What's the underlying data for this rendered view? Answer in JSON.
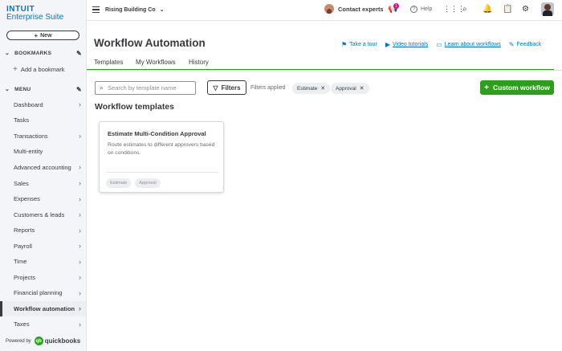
{
  "brand": {
    "logo": "INTUIT",
    "product": "Enterprise Suite",
    "powered_by": "Powered by",
    "qb": "quickbooks",
    "qb_mark": "qb"
  },
  "sidebar": {
    "new_label": "New",
    "bookmarks_header": "BOOKMARKS",
    "add_bookmark": "Add a bookmark",
    "menu_header": "MENU",
    "items": [
      {
        "label": "Dashboard",
        "arrow": true
      },
      {
        "label": "Tasks",
        "arrow": false
      },
      {
        "label": "Transactions",
        "arrow": true
      },
      {
        "label": "Multi-entity",
        "arrow": false
      },
      {
        "label": "Advanced accounting",
        "arrow": true
      },
      {
        "label": "Sales",
        "arrow": true
      },
      {
        "label": "Expenses",
        "arrow": true
      },
      {
        "label": "Customers & leads",
        "arrow": true
      },
      {
        "label": "Reports",
        "arrow": true
      },
      {
        "label": "Payroll",
        "arrow": true
      },
      {
        "label": "Time",
        "arrow": true
      },
      {
        "label": "Projects",
        "arrow": true
      },
      {
        "label": "Financial planning",
        "arrow": true
      },
      {
        "label": "Workflow automation",
        "arrow": true,
        "active": true
      },
      {
        "label": "Taxes",
        "arrow": true
      }
    ]
  },
  "topbar": {
    "company": "Rising Building Co",
    "contact": "Contact experts",
    "help": "Help",
    "notification_count": "1"
  },
  "page": {
    "title": "Workflow Automation",
    "links": [
      "Take a tour",
      "Video tutorials",
      "Learn about workflows",
      "Feedback"
    ],
    "tabs": [
      "Templates",
      "My Workflows",
      "History"
    ],
    "search_placeholder": "Search by template name",
    "filters_label": "Filters",
    "filters_applied": "Filters applied",
    "chips": [
      "Estimate",
      "Approval"
    ],
    "custom_button": "Custom workflow",
    "section_title": "Workflow templates"
  },
  "card": {
    "title": "Estimate Multi-Condition Approval",
    "description": "Route estimates to different approvers based on conditions.",
    "tags": [
      "Estimate",
      "Approval"
    ]
  },
  "colors": {
    "brand_blue": "#0077c5",
    "green": "#2ca01c",
    "badge": "#c4158b"
  }
}
